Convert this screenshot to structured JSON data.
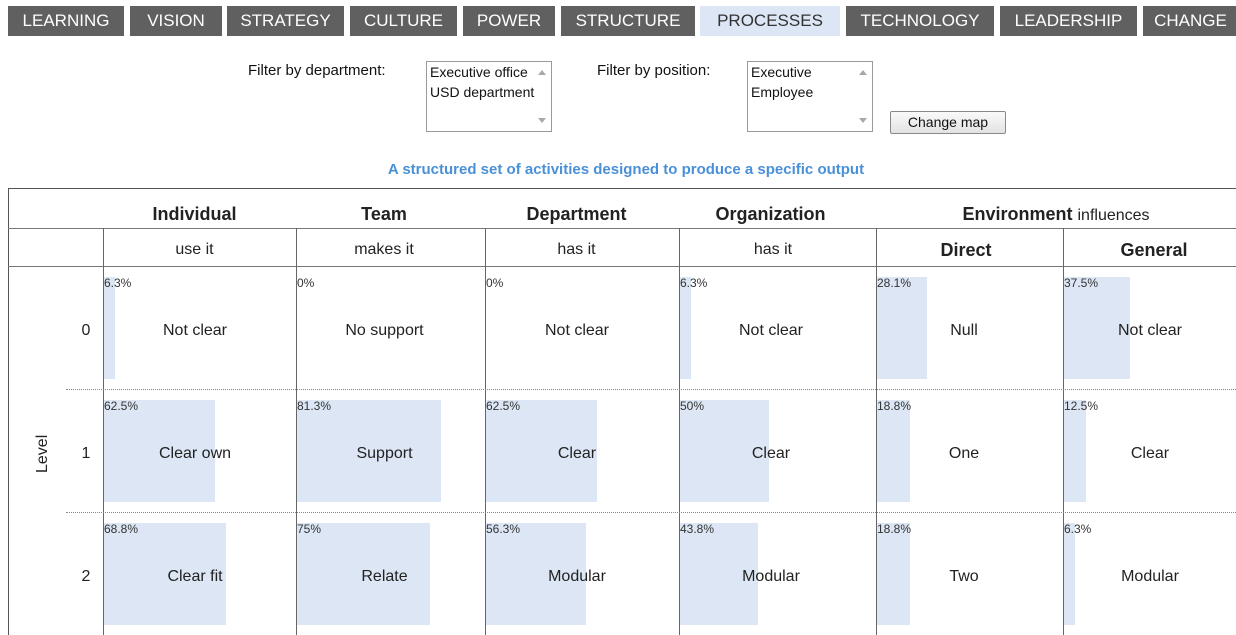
{
  "tabs": [
    {
      "label": "LEARNING",
      "active": false
    },
    {
      "label": "VISION",
      "active": false
    },
    {
      "label": "STRATEGY",
      "active": false
    },
    {
      "label": "CULTURE",
      "active": false
    },
    {
      "label": "POWER",
      "active": false
    },
    {
      "label": "STRUCTURE",
      "active": false
    },
    {
      "label": "PROCESSES",
      "active": true
    },
    {
      "label": "TECHNOLOGY",
      "active": false
    },
    {
      "label": "LEADERSHIP",
      "active": false
    },
    {
      "label": "CHANGE",
      "active": false
    }
  ],
  "filters": {
    "department": {
      "label": "Filter by department:",
      "options": [
        "Executive office",
        "USD department"
      ]
    },
    "position": {
      "label": "Filter by position:",
      "options": [
        "Executive",
        "Employee"
      ]
    },
    "button_label": "Change map"
  },
  "subtitle": "A structured set of activities designed to produce a specific output",
  "columns": {
    "individual": {
      "title": "Individual",
      "sub": "use it"
    },
    "team": {
      "title": "Team",
      "sub": "makes it"
    },
    "department": {
      "title": "Department",
      "sub": "has it"
    },
    "organization": {
      "title": "Organization",
      "sub": "has it"
    },
    "environment": {
      "title": "Environment",
      "suffix": "influences",
      "direct": "Direct",
      "general": "General"
    }
  },
  "level_label": "Level",
  "rows": [
    {
      "level": "0",
      "cells": [
        {
          "pct": "6.3%",
          "value": 6.3,
          "label": "Not clear"
        },
        {
          "pct": "0%",
          "value": 0,
          "label": "No support"
        },
        {
          "pct": "0%",
          "value": 0,
          "label": "Not clear"
        },
        {
          "pct": "6.3%",
          "value": 6.3,
          "label": "Not clear"
        },
        {
          "pct": "28.1%",
          "value": 28.1,
          "label": "Null"
        },
        {
          "pct": "37.5%",
          "value": 37.5,
          "label": "Not clear"
        }
      ]
    },
    {
      "level": "1",
      "cells": [
        {
          "pct": "62.5%",
          "value": 62.5,
          "label": "Clear own"
        },
        {
          "pct": "81.3%",
          "value": 81.3,
          "label": "Support"
        },
        {
          "pct": "62.5%",
          "value": 62.5,
          "label": "Clear"
        },
        {
          "pct": "50%",
          "value": 50,
          "label": "Clear"
        },
        {
          "pct": "18.8%",
          "value": 18.8,
          "label": "One"
        },
        {
          "pct": "12.5%",
          "value": 12.5,
          "label": "Clear"
        }
      ]
    },
    {
      "level": "2",
      "cells": [
        {
          "pct": "68.8%",
          "value": 68.8,
          "label": "Clear fit"
        },
        {
          "pct": "75%",
          "value": 75,
          "label": "Relate"
        },
        {
          "pct": "56.3%",
          "value": 56.3,
          "label": "Modular"
        },
        {
          "pct": "43.8%",
          "value": 43.8,
          "label": "Modular"
        },
        {
          "pct": "18.8%",
          "value": 18.8,
          "label": "Two"
        },
        {
          "pct": "6.3%",
          "value": 6.3,
          "label": "Modular"
        }
      ]
    }
  ],
  "colors": {
    "bar": "#dce6f4",
    "tab": "#606060",
    "tab_active": "#dce6f4",
    "subtitle": "#4a90d9"
  }
}
